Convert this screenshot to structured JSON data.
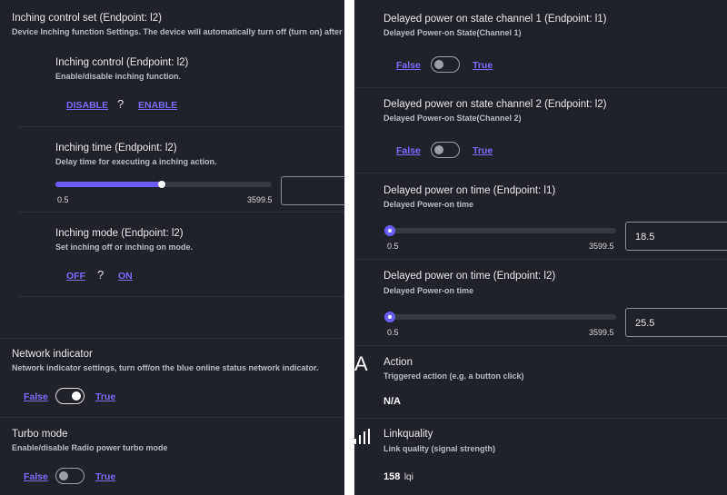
{
  "left": {
    "inching_set": {
      "title": "Inching control set (Endpoint: l2)",
      "desc": "Device Inching function Settings. The device will automatically turn off (turn on) after each"
    },
    "inching_control": {
      "title": "Inching control (Endpoint: l2)",
      "desc": "Enable/disable inching function.",
      "disable_label": "DISABLE",
      "state": "?",
      "enable_label": "ENABLE"
    },
    "inching_time": {
      "title": "Inching time (Endpoint: l2)",
      "desc": "Delay time for executing a inching action.",
      "min": "0.5",
      "max": "3599.5",
      "slider_fraction": 0.5,
      "value": ""
    },
    "inching_mode": {
      "title": "Inching mode (Endpoint: l2)",
      "desc": "Set inching off or inching on mode.",
      "off_label": "OFF",
      "state": "?",
      "on_label": "ON"
    },
    "network_indicator": {
      "title": "Network indicator",
      "desc": "Network indicator settings, turn off/on the blue online status network indicator.",
      "false_label": "False",
      "true_label": "True",
      "on": true
    },
    "turbo_mode": {
      "title": "Turbo mode",
      "desc": "Enable/disable Radio power turbo mode",
      "false_label": "False",
      "true_label": "True",
      "on": false
    }
  },
  "right": {
    "delayed_state_1": {
      "title": "Delayed power on state channel 1 (Endpoint: l1)",
      "desc": "Delayed Power-on State(Channel 1)",
      "false_label": "False",
      "true_label": "True",
      "on": false
    },
    "delayed_state_2": {
      "title": "Delayed power on state channel 2 (Endpoint: l2)",
      "desc": "Delayed Power-on State(Channel 2)",
      "false_label": "False",
      "true_label": "True",
      "on": false
    },
    "delayed_time_1": {
      "title": "Delayed power on time (Endpoint: l1)",
      "desc": "Delayed Power-on time",
      "min": "0.5",
      "max": "3599.5",
      "value": "18.5"
    },
    "delayed_time_2": {
      "title": "Delayed power on time (Endpoint: l2)",
      "desc": "Delayed Power-on time",
      "min": "0.5",
      "max": "3599.5",
      "value": "25.5"
    },
    "action": {
      "icon_text": "A",
      "title": "Action",
      "desc": "Triggered action (e.g. a button click)",
      "value": "N/A"
    },
    "linkquality": {
      "title": "Linkquality",
      "desc": "Link quality (signal strength)",
      "value": "158",
      "unit": "lqi"
    }
  }
}
